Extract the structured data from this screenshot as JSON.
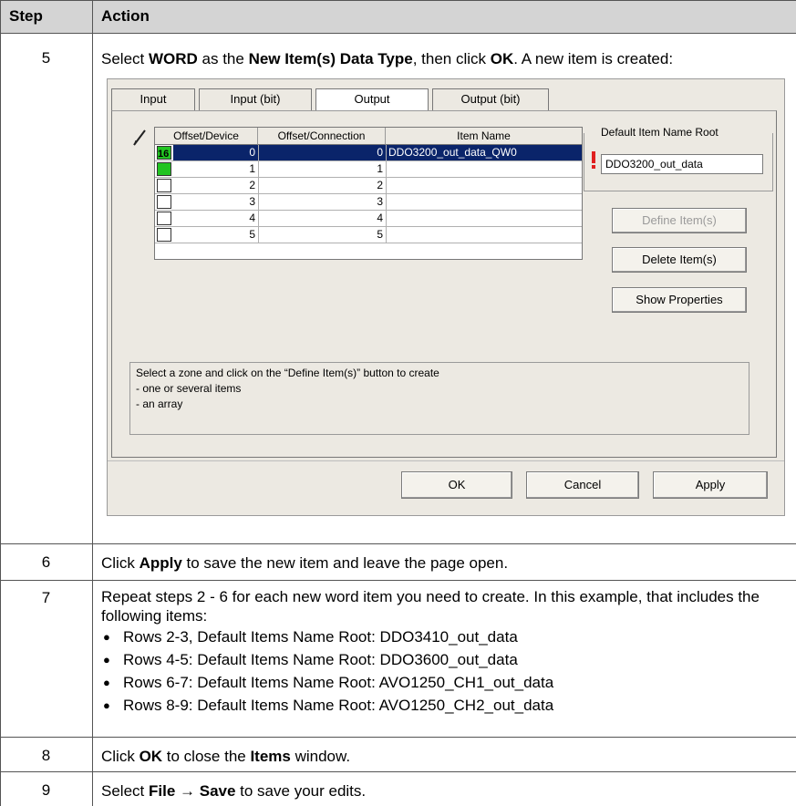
{
  "table": {
    "header": {
      "step": "Step",
      "action": "Action"
    },
    "rows": [
      {
        "step": "5"
      },
      {
        "step": "6"
      },
      {
        "step": "7"
      },
      {
        "step": "8"
      },
      {
        "step": "9"
      }
    ]
  },
  "step5": {
    "t1": "Select ",
    "b1": "WORD",
    "t2": " as the ",
    "b2": "New Item(s) Data Type",
    "t3": ", then click ",
    "b3": "OK",
    "t4": ". A new item is created:"
  },
  "step6": {
    "t1": "Click ",
    "b1": "Apply",
    "t2": " to save the new item and leave the page open."
  },
  "step7": {
    "intro": "Repeat steps 2 - 6 for each new word item you need to create. In this example, that includes the following items:",
    "items": [
      "Rows 2-3, Default Items Name Root: DDO3410_out_data",
      "Rows 4-5: Default Items Name Root: DDO3600_out_data",
      "Rows 6-7: Default Items Name Root: AVO1250_CH1_out_data",
      "Rows 8-9: Default Items Name Root: AVO1250_CH2_out_data"
    ]
  },
  "step8": {
    "t1": "Click ",
    "b1": "OK",
    "t2": " to close the ",
    "b2": "Items",
    "t3": " window."
  },
  "step9": {
    "t1": "Select ",
    "b1": "File",
    "arrow": " → ",
    "b2": "Save",
    "t2": " to save your edits."
  },
  "dialog": {
    "tabs": [
      "Input",
      "Input (bit)",
      "Output",
      "Output (bit)"
    ],
    "active_tab": "Output",
    "columns": [
      "Offset/Device",
      "Offset/Connection",
      "Item Name"
    ],
    "rows": [
      {
        "badge": "16",
        "device": "0",
        "connection": "0",
        "name": "DDO3200_out_data_QW0",
        "selected": true,
        "checked": true
      },
      {
        "badge": "",
        "device": "1",
        "connection": "1",
        "name": "",
        "selected": false,
        "checked": true
      },
      {
        "badge": "",
        "device": "2",
        "connection": "2",
        "name": "",
        "selected": false,
        "checked": false
      },
      {
        "badge": "",
        "device": "3",
        "connection": "3",
        "name": "",
        "selected": false,
        "checked": false
      },
      {
        "badge": "",
        "device": "4",
        "connection": "4",
        "name": "",
        "selected": false,
        "checked": false
      },
      {
        "badge": "",
        "device": "5",
        "connection": "5",
        "name": "",
        "selected": false,
        "checked": false
      }
    ],
    "name_root_label": "Default Item Name Root",
    "name_root_value": "DDO3200_out_data",
    "define_button": "Define Item(s)",
    "delete_button": "Delete Item(s)",
    "props_button": "Show Properties",
    "help_lines": [
      "Select a zone and click on the “Define Item(s)” button to create",
      "- one or several items",
      "- an array"
    ],
    "ok_button": "OK",
    "cancel_button": "Cancel",
    "apply_button": "Apply",
    "colors": {
      "selection": "#0a246a",
      "checked": "#22c422",
      "warning": "#e02020"
    }
  }
}
